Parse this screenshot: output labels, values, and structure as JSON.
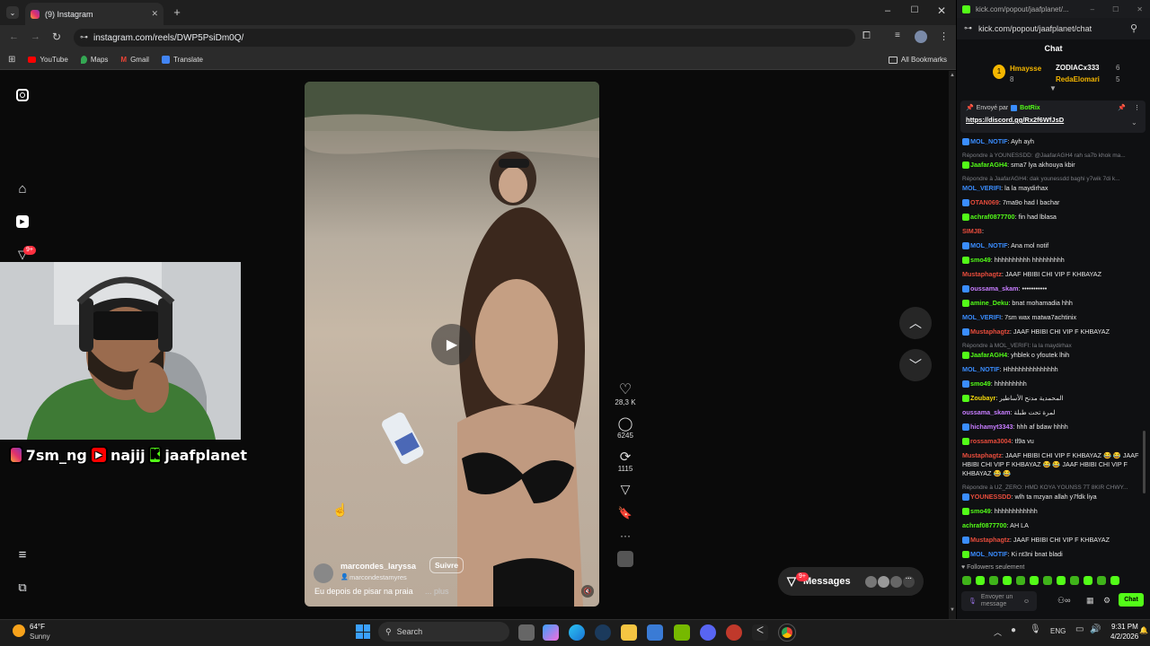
{
  "browser": {
    "tab_title": "(9) Instagram",
    "url": "instagram.com/reels/DWP5PsiDm0Q/",
    "bookmarks": [
      "YouTube",
      "Maps",
      "Gmail",
      "Translate"
    ],
    "all_bookmarks": "All Bookmarks"
  },
  "instagram": {
    "notification_badge": "9+",
    "reel": {
      "username": "marcondes_laryssa",
      "follow_label": "Suivre",
      "collab": "marcondestamyres",
      "caption": "Eu depois de pisar na praia",
      "more": "... plus"
    },
    "actions": {
      "likes": "28,3 K",
      "comments": "6245",
      "reposts": "1115"
    },
    "messages_label": "Messages",
    "messages_badge": "9+"
  },
  "stream_overlay": {
    "instagram": "7sm_ng",
    "youtube": "najij",
    "kick": "jaafplanet"
  },
  "kick": {
    "window_url_small": "kick.com/popout/jaafplanet/...",
    "url": "kick.com/popout/jaafplanet/chat",
    "chat_title": "Chat",
    "gifters": [
      {
        "name": "Hmaysse",
        "count": "8"
      },
      {
        "name": "ZODIACx333",
        "count": "6"
      },
      {
        "name": "RedaElomari",
        "count": "5"
      }
    ],
    "pinned": {
      "sent_by": "Envoyé par",
      "bot": "BotRix",
      "link": "https://discord.gg/Rx2f6WfJsD"
    },
    "messages": [
      {
        "user": "MOL_NOTIF",
        "text": "Ayh ayh",
        "color": "#3a8dff"
      },
      {
        "reply": "Répondre à YOUNESSDD: @JaafarAGH4 rah sa7b khok ma...",
        "user": "JaafarAGH4",
        "text": "sma7 lya akhouya kbir",
        "color": "#53fc18"
      },
      {
        "reply": "Répondre à JaafarAGH4: dak younessdd baghi y7wik 7di k...",
        "user": "MOL_VERIFI",
        "text": "la la maydirhax",
        "color": "#3a8dff"
      },
      {
        "user": "OTAN069",
        "text": "7ma9o had l bachar",
        "color": "#e74c3c"
      },
      {
        "user": "achraf0877700",
        "text": "fin had lblasa",
        "color": "#53fc18"
      },
      {
        "user": "SIMJB",
        "text": "",
        "color": "#e74c3c"
      },
      {
        "user": "MOL_NOTIF",
        "text": "Ana mol notif",
        "color": "#3a8dff"
      },
      {
        "user": "smo49",
        "text": "hhhhhhhhhh hhhhhhhhh",
        "color": "#53fc18"
      },
      {
        "user": "Mustaphagtz",
        "text": "JAAF HBIBI CHI VIP F KHBAYAZ",
        "color": "#e74c3c"
      },
      {
        "user": "oussama_skam",
        "text": "•••••••••••",
        "color": "#c77dff"
      },
      {
        "user": "amine_Deku",
        "text": "bnat mohamadia hhh",
        "color": "#53fc18"
      },
      {
        "user": "MOL_VERIFI",
        "text": "7sm wax matwa7achtinix",
        "color": "#3a8dff"
      },
      {
        "user": "Mustaphagtz",
        "text": "JAAF HBIBI CHI VIP F KHBAYAZ",
        "color": "#e74c3c"
      },
      {
        "reply": "Répondre à MOL_VERIFI: la la maydirhax",
        "user": "JaafarAGH4",
        "text": "yhblek o yfoutek lhih",
        "color": "#53fc18"
      },
      {
        "user": "MOL_NOTIF",
        "text": "Hhhhhhhhhhhhhhh",
        "color": "#3a8dff"
      },
      {
        "user": "smo49",
        "text": "hhhhhhhhh",
        "color": "#53fc18"
      },
      {
        "user": "Zoubayr",
        "text": "المحمدية مدنح الأساطير",
        "color": "#f5d90a"
      },
      {
        "user": "oussama_skam",
        "text": "لمرة تحت طبلة",
        "color": "#c77dff"
      },
      {
        "user": "hichamyt3343",
        "text": "hhh af bdaw hhhh",
        "color": "#c77dff"
      },
      {
        "user": "rossama3004",
        "text": "tl9a vu",
        "color": "#e74c3c"
      },
      {
        "user": "Mustaphagtz",
        "text": "JAAF HBIBI CHI VIP F KHBAYAZ 😂 😂 JAAF HBIBI CHI VIP F KHBAYAZ 😂 😂 JAAF HBIBI CHI VIP F KHBAYAZ 😂 😂",
        "color": "#e74c3c"
      },
      {
        "reply": "Répondre à UZ_ZERO: HMD KOYA YOUNSS 7T 8KIR CHWY...",
        "user": "YOUNESSDD",
        "text": "wlh ta mzyan allah y7fdk liya",
        "color": "#e74c3c"
      },
      {
        "user": "smo49",
        "text": "hhhhhhhhhhhh",
        "color": "#53fc18"
      },
      {
        "user": "achraf0877700",
        "text": "AH LA",
        "color": "#53fc18"
      },
      {
        "user": "Mustaphagtz",
        "text": "JAAF HBIBI CHI VIP F KHBAYAZ",
        "color": "#e74c3c"
      },
      {
        "user": "MOL_NOTIF",
        "text": "Ki nt3ni bnat bladi",
        "color": "#3a8dff"
      }
    ],
    "followers_only": "Followers seulement",
    "input_placeholder": "Envoyer un message",
    "chat_button": "Chat"
  },
  "taskbar": {
    "weather_temp": "64°F",
    "weather_desc": "Sunny",
    "search_placeholder": "Search",
    "language": "ENG",
    "time": "9:31 PM",
    "date": "4/2/2026"
  }
}
